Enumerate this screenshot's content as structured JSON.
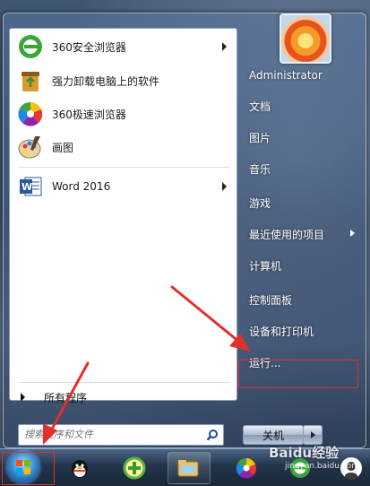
{
  "start_menu": {
    "programs": [
      {
        "label": "360安全浏览器",
        "icon": "360-browser-icon",
        "has_submenu": true
      },
      {
        "label": "强力卸载电脑上的软件",
        "icon": "uninstall-icon",
        "has_submenu": false
      },
      {
        "label": "360极速浏览器",
        "icon": "360-speed-browser-icon",
        "has_submenu": false
      },
      {
        "label": "画图",
        "icon": "paint-icon",
        "has_submenu": false
      },
      {
        "label": "Word 2016",
        "icon": "word-icon",
        "has_submenu": true
      }
    ],
    "all_programs_label": "所有程序",
    "search_placeholder": "搜索程序和文件",
    "right_items": [
      {
        "label": "Administrator",
        "has_submenu": false
      },
      {
        "label": "文档",
        "has_submenu": false
      },
      {
        "label": "图片",
        "has_submenu": false
      },
      {
        "label": "音乐",
        "has_submenu": false
      },
      {
        "label": "游戏",
        "has_submenu": false
      },
      {
        "label": "最近使用的项目",
        "has_submenu": true
      },
      {
        "label": "计算机",
        "has_submenu": false
      },
      {
        "label": "控制面板",
        "has_submenu": false
      },
      {
        "label": "设备和打印机",
        "has_submenu": false
      },
      {
        "label": "运行...",
        "has_submenu": false
      }
    ],
    "shutdown_label": "关机"
  },
  "taskbar": {
    "items": [
      {
        "icon": "start-orb-icon"
      },
      {
        "icon": "qq-icon"
      },
      {
        "icon": "360-guard-icon"
      },
      {
        "icon": "file-explorer-icon"
      },
      {
        "icon": "360-speed-browser-icon"
      },
      {
        "icon": "360-browser-icon"
      },
      {
        "icon": "user-avatar-icon"
      }
    ]
  },
  "watermark": {
    "text": "Baidu经验",
    "sub": "jingyan.baidu.com"
  },
  "colors": {
    "highlight_red": "#e0302b",
    "menu_text": "#ffffff"
  }
}
